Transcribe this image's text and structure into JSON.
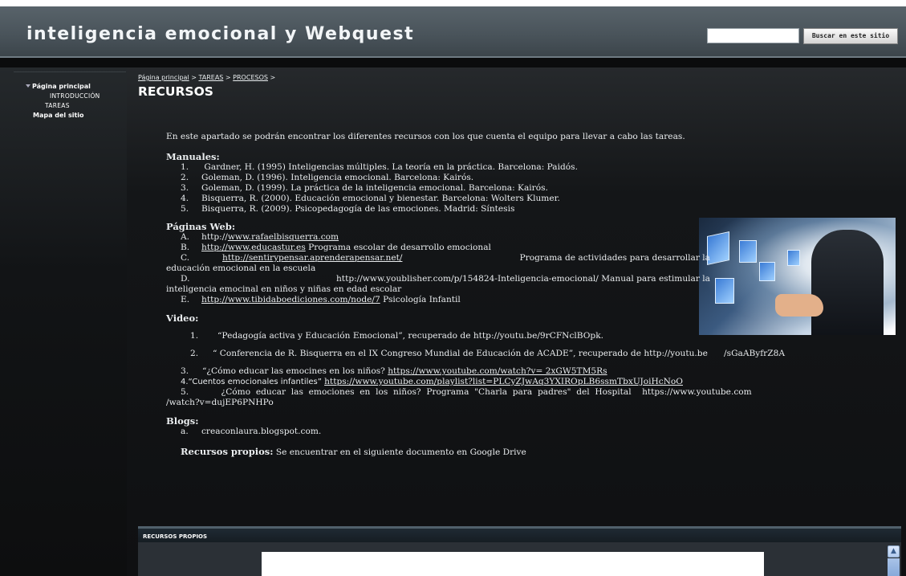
{
  "header": {
    "title": "inteligencia emocional y Webquest",
    "search_button": "Buscar en este sitio",
    "search_value": ""
  },
  "sidebar": {
    "items": [
      {
        "label": "Página principal"
      },
      {
        "label": "INTRODUCCIÓN"
      },
      {
        "label": "TAREAS"
      },
      {
        "label": "Mapa del sitio"
      }
    ]
  },
  "breadcrumb": {
    "items": [
      "Página principal",
      "TAREAS",
      "PROCESOS"
    ],
    "separator": ">"
  },
  "page": {
    "title": "RECURSOS",
    "intro": "En este apartado se podrán encontrar los diferentes recursos con los que cuenta el equipo para llevar  a cabo las tareas."
  },
  "manuales": {
    "title": "Manuales:",
    "items": [
      {
        "n": "1.",
        "text": " Gardner, H. (1995) Inteligencias múltiples. La teoría en la práctica. Barcelona: Paidós."
      },
      {
        "n": "2.",
        "text": "Goleman, D. (1996). Inteligencia emocional. Barcelona: Kairós."
      },
      {
        "n": "3.",
        "text": "Goleman, D. (1999). La práctica de la inteligencia emocional. Barcelona: Kairós."
      },
      {
        "n": "4.",
        "text": "Bisquerra, R. (2000). Educación emocional y bienestar. Barcelona: Wolters Klumer."
      },
      {
        "n": "5.",
        "text": "Bisquerra, R. (2009). Psicopedagogía de las emociones. Madrid: Síntesis"
      }
    ]
  },
  "web": {
    "title": "Páginas Web:",
    "a_n": "A.",
    "a_pre": "http://",
    "a_link": "www.rafaelbisquerra.com",
    "b_n": "B.",
    "b_link": "http://www.educastur.es",
    "b_text": " Programa escolar de desarrollo emocional",
    "c_n": "C.",
    "c_link": "http://sentirypensar.aprenderapensar.net/",
    "c_text": " Programa de actividades para desarrollar la",
    "c_text2": "educación emocional en la escuela",
    "d_n": "D.",
    "d_text": "http://www.youblisher.com/p/154824-Inteligencia-emocional/ Manual para estimular la",
    "d_text2": "inteligencia emocinal en niños y niñas en edad escolar",
    "e_n": "E.",
    "e_link": "http://www.tibidaboediciones.com/node/7",
    "e_text": " Psicología Infantil"
  },
  "video": {
    "title": "Video:",
    "v1_n": "1.",
    "v1_text": "“Pedagogía activa y Educación Emocional”, recuperado de http://youtu.be/9rCFNclBOpk.",
    "v2_n": "2.",
    "v2_text": "“ Conferencia de R. Bisquerra en el IX Congreso Mundial de Educación de ACADE”, recuperado de http://youtu.be      /sGaAByfrZ8A",
    "v3_text": "3.     “¿Cómo educar las emocines en los niños? ",
    "v3_link": "https://www.youtube.com/watch?v= 2xGW5TM5Rs",
    "v4_text": "4.“Cuentos emocionales infantiles” ",
    "v4_link": "https://www.youtube.com/playlist?list=PLCyZJwAq3YXIROpLB6ssmTbxUJoiHcNoO",
    "v5_text": "5.            ¿Cómo  educar  las  emociones  en  los  niños?  Programa  \"Charla  para  padres\"  del  Hospital    https://www.youtube.com",
    "v5_text2": "/watch?v=dujEP6PNHPo"
  },
  "blogs": {
    "title": "Blogs:",
    "items": [
      {
        "n": "a.",
        "text": "creaconlaura.blogspot.com."
      }
    ]
  },
  "propios": {
    "label": "Recursos propios:",
    "text": " Se encuentrar en el siguiente documento en Google Drive",
    "embed_title": "RECURSOS PROPIOS"
  }
}
